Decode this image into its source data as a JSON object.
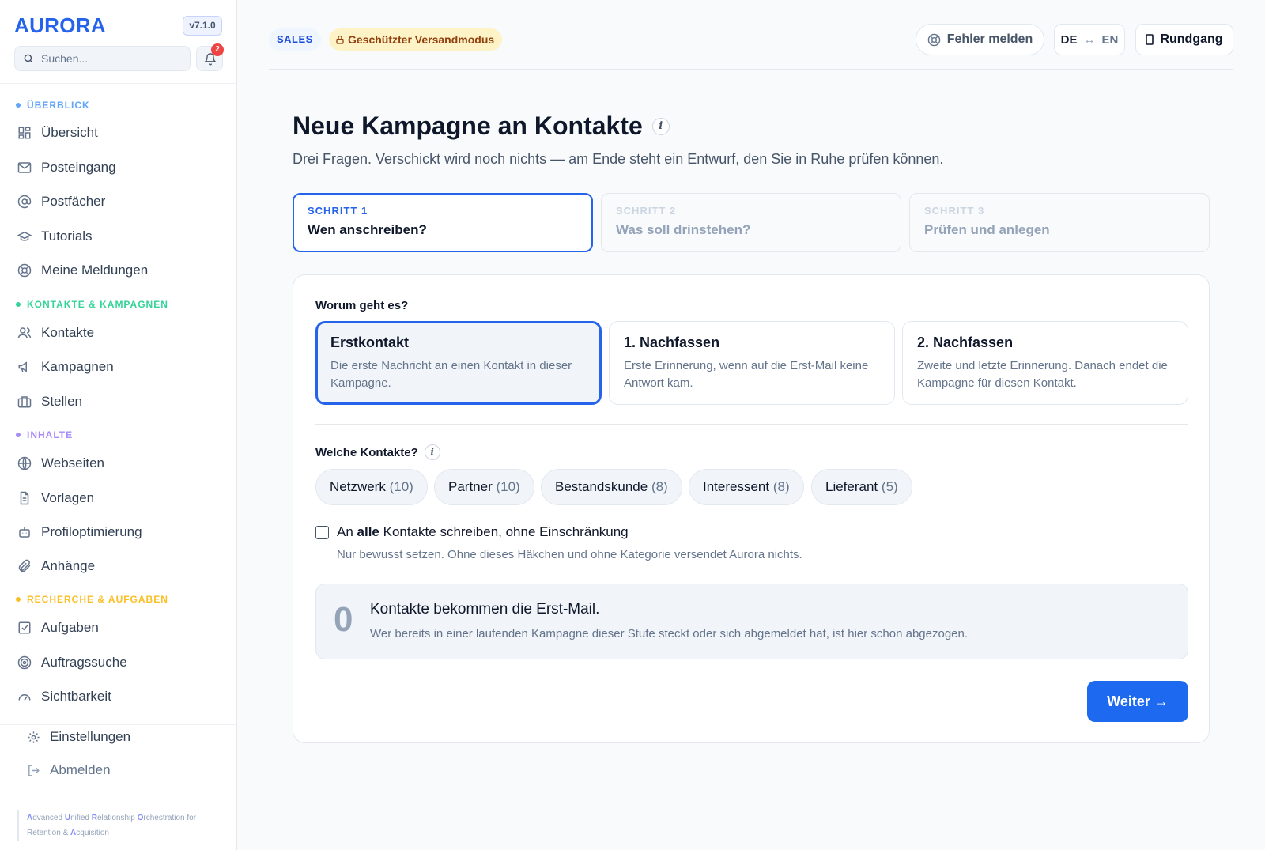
{
  "app": {
    "logo": "AURORA",
    "version": "v7.1.0",
    "search_placeholder": "Suchen...",
    "notification_count": "2"
  },
  "sidebar": {
    "sections": [
      {
        "label": "ÜBERBLICK",
        "color": "#60a5fa",
        "items": [
          "Übersicht",
          "Posteingang",
          "Postfächer",
          "Tutorials",
          "Meine Meldungen"
        ]
      },
      {
        "label": "KONTAKTE & KAMPAGNEN",
        "color": "#34d399",
        "items": [
          "Kontakte",
          "Kampagnen",
          "Stellen"
        ]
      },
      {
        "label": "INHALTE",
        "color": "#a78bfa",
        "items": [
          "Webseiten",
          "Vorlagen",
          "Profiloptimierung",
          "Anhänge"
        ]
      },
      {
        "label": "RECHERCHE & AUFGABEN",
        "color": "#fbbf24",
        "items": [
          "Aufgaben",
          "Auftragssuche",
          "Sichtbarkeit"
        ]
      }
    ],
    "footer": {
      "settings": "Einstellungen",
      "logout": "Abmelden"
    },
    "tagline": [
      [
        [
          "A",
          "dvanced "
        ],
        [
          "U",
          "nified "
        ],
        [
          "R",
          "elationship "
        ],
        [
          "O",
          "rchestration for"
        ]
      ],
      [
        [
          "",
          "Retention & "
        ],
        [
          "A",
          "cquisition"
        ]
      ]
    ]
  },
  "topbar": {
    "sales_chip": "SALES",
    "protected_chip": "Geschützter Versandmodus",
    "report_bug": "Fehler melden",
    "lang_de": "DE",
    "lang_arrow": "↔",
    "lang_en": "EN",
    "tour": "Rundgang"
  },
  "page": {
    "title": "Neue Kampagne an Kontakte",
    "info_glyph": "i",
    "subtitle": "Drei Fragen. Verschickt wird noch nichts — am Ende steht ein Entwurf, den Sie in Ruhe prüfen können."
  },
  "steps": [
    {
      "label": "SCHRITT 1",
      "title": "Wen anschreiben?",
      "active": true
    },
    {
      "label": "SCHRITT 2",
      "title": "Was soll drinstehen?",
      "active": false
    },
    {
      "label": "SCHRITT 3",
      "title": "Prüfen und anlegen",
      "active": false
    }
  ],
  "form": {
    "topic_label": "Worum geht es?",
    "options": [
      {
        "title": "Erstkontakt",
        "desc": "Die erste Nachricht an einen Kontakt in dieser Kampagne.",
        "selected": true
      },
      {
        "title": "1. Nachfassen",
        "desc": "Erste Erinnerung, wenn auf die Erst-Mail keine Antwort kam.",
        "selected": false
      },
      {
        "title": "2. Nachfassen",
        "desc": "Zweite und letzte Erinnerung. Danach endet die Kampagne für diesen Kontakt.",
        "selected": false
      }
    ],
    "contacts_label": "Welche Kontakte?",
    "categories": [
      {
        "name": "Netzwerk",
        "count": "(10)"
      },
      {
        "name": "Partner",
        "count": "(10)"
      },
      {
        "name": "Bestandskunde",
        "count": "(8)"
      },
      {
        "name": "Interessent",
        "count": "(8)"
      },
      {
        "name": "Lieferant",
        "count": "(5)"
      }
    ],
    "all_contacts": {
      "pre": "An ",
      "bold": "alle",
      "post": " Kontakte schreiben, ohne Einschränkung",
      "checked": false
    },
    "all_contacts_hint": "Nur bewusst setzen. Ohne dieses Häkchen und ohne Kategorie versendet Aurora nichts.",
    "summary": {
      "count": "0",
      "title": "Kontakte bekommen die Erst-Mail.",
      "desc": "Wer bereits in einer laufenden Kampagne dieser Stufe steckt oder sich abgemeldet hat, ist hier schon abgezogen."
    },
    "next_button": "Weiter →"
  }
}
